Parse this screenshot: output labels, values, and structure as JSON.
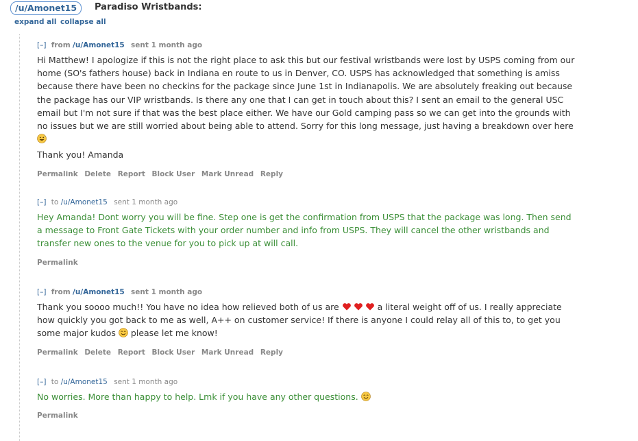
{
  "header": {
    "username": "/u/Amonet15",
    "subject": "Paradiso Wristbands:",
    "expand_all": "expand all",
    "collapse_all": "collapse all"
  },
  "messages": [
    {
      "toggle": "[–]",
      "direction": "from",
      "user": "/u/Amonet15",
      "age": "sent 1 month ago",
      "paragraphs": [
        "Hi Matthew! I apologize if this is not the right place to ask this but our festival wristbands were lost by USPS coming from our home (SO's fathers house) back in Indiana en route to us in Denver, CO. USPS has acknowledged that something is amiss because there have been no checkins for the package since June 1st in Indianapolis. We are absolutely freaking out because the package has our VIP wristbands. Is there any one that I can get in touch about this? I sent an email to the general USC email but I'm not sure if that was the best place either. We have our Gold camping pass so we can get into the grounds with no issues but we are still worried about being able to attend. Sorry for this long message, just having a breakdown over here",
        "Thank you! Amanda"
      ],
      "emoji": "grinning-sweat-emoji",
      "actions": [
        "Permalink",
        "Delete",
        "Report",
        "Block User",
        "Mark Unread",
        "Reply"
      ]
    },
    {
      "toggle": "[–]",
      "direction": "to",
      "user": "/u/Amonet15",
      "age": "sent 1 month ago",
      "paragraphs": [
        "Hey Amanda! Dont worry you will be fine. Step one is get the confirmation from USPS that the package was long. Then send a message to Front Gate Tickets with your order number and info from USPS. They will cancel the other wristbands and transfer new ones to the venue for you to pick up at will call."
      ],
      "actions": [
        "Permalink"
      ]
    },
    {
      "toggle": "[–]",
      "direction": "from",
      "user": "/u/Amonet15",
      "age": "sent 1 month ago",
      "text_a": "Thank you soooo much!! You have no idea how relieved both of us are",
      "text_b": "a literal weight off of us. I really appreciate how quickly you got back to me as well, A++ on customer service! If there is anyone I could relay all of this to, to get you some major kudos",
      "text_c": "please let me know!",
      "emojis": [
        "red-heart-emoji",
        "red-heart-emoji",
        "red-heart-emoji",
        "smiling-emoji"
      ],
      "actions": [
        "Permalink",
        "Delete",
        "Report",
        "Block User",
        "Mark Unread",
        "Reply"
      ]
    },
    {
      "toggle": "[–]",
      "direction": "to",
      "user": "/u/Amonet15",
      "age": "sent 1 month ago",
      "text": "No worries. More than happy to help. Lmk if you have any other questions.",
      "emoji": "smiling-emoji",
      "actions": [
        "Permalink"
      ]
    }
  ],
  "colors": {
    "link": "#336699",
    "reply_text": "#3a8e36",
    "meta": "#888888"
  }
}
